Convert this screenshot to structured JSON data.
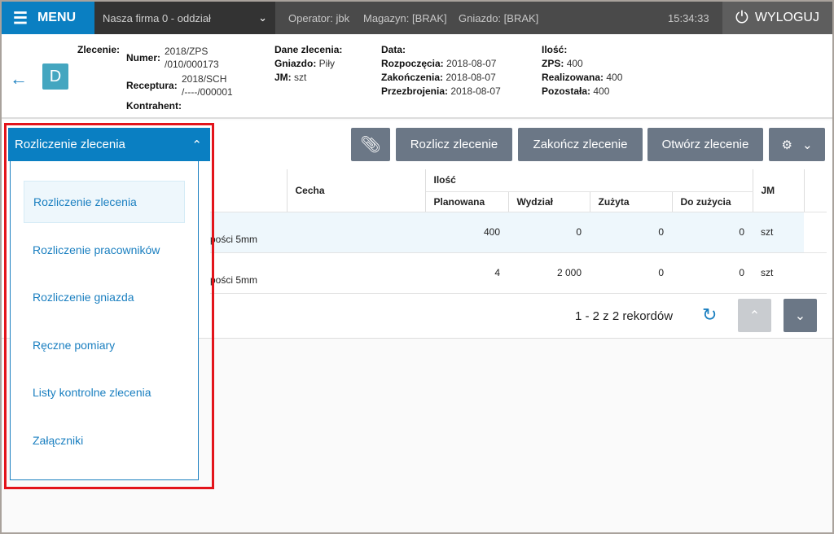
{
  "topbar": {
    "menu": "MENU",
    "firm": "Nasza firma 0 - oddział",
    "operator_label": "Operator:",
    "operator": "jbk",
    "magazyn_label": "Magazyn:",
    "magazyn": "[BRAK]",
    "gniazdo_label": "Gniazdo:",
    "gniazdo": "[BRAK]",
    "time": "15:34:33",
    "logout": "WYLOGUJ"
  },
  "header": {
    "badge": "D",
    "zlecenie": "Zlecenie:",
    "numer_label": "Numer:",
    "numer_1": "2018/ZPS",
    "numer_2": "/010/000173",
    "receptura_label": "Receptura:",
    "receptura_1": "2018/SCH",
    "receptura_2": "/----/000001",
    "kontrahent_label": "Kontrahent:",
    "dane_label": "Dane zlecenia:",
    "gniazdo_label": "Gniazdo:",
    "gniazdo": "Piły",
    "jm_label": "JM:",
    "jm": "szt",
    "data_label": "Data:",
    "rozp_label": "Rozpoczęcia:",
    "rozp": "2018-08-07",
    "zak_label": "Zakończenia:",
    "zak": "2018-08-07",
    "prz_label": "Przezbrojenia:",
    "prz": "2018-08-07",
    "ilosc_label": "Ilość:",
    "zps_label": "ZPS:",
    "zps": "400",
    "real_label": "Realizowana:",
    "real": "400",
    "poz_label": "Pozostała:",
    "poz": "400"
  },
  "toolbar": {
    "rozlicz": "Rozlicz zlecenie",
    "zakoncz": "Zakończ zlecenie",
    "otworz": "Otwórz zlecenie"
  },
  "table": {
    "cecha": "Cecha",
    "ilosc": "Ilość",
    "planowana": "Planowana",
    "wydzial": "Wydział",
    "zuzyta": "Zużyta",
    "do_zuzycia": "Do zużycia",
    "jm": "JM",
    "rows": [
      {
        "name": "pości 5mm",
        "planowana": "400",
        "wydzial": "0",
        "zuzyta": "0",
        "do_zuzycia": "0",
        "jm": "szt"
      },
      {
        "name": "pości 5mm",
        "planowana": "4",
        "wydzial": "2 000",
        "zuzyta": "0",
        "do_zuzycia": "0",
        "jm": "szt"
      }
    ]
  },
  "pagination": {
    "text": "1 - 2 z 2 rekordów"
  },
  "dropdown": {
    "selected": "Rozliczenie zlecenia",
    "items": [
      "Rozliczenie zlecenia",
      "Rozliczenie pracowników",
      "Rozliczenie gniazda",
      "Ręczne pomiary",
      "Listy kontrolne zlecenia",
      "Załączniki"
    ]
  },
  "colors": {
    "primary": "#0a7fc2",
    "button": "#6b7786",
    "highlight": "#e3141b"
  }
}
